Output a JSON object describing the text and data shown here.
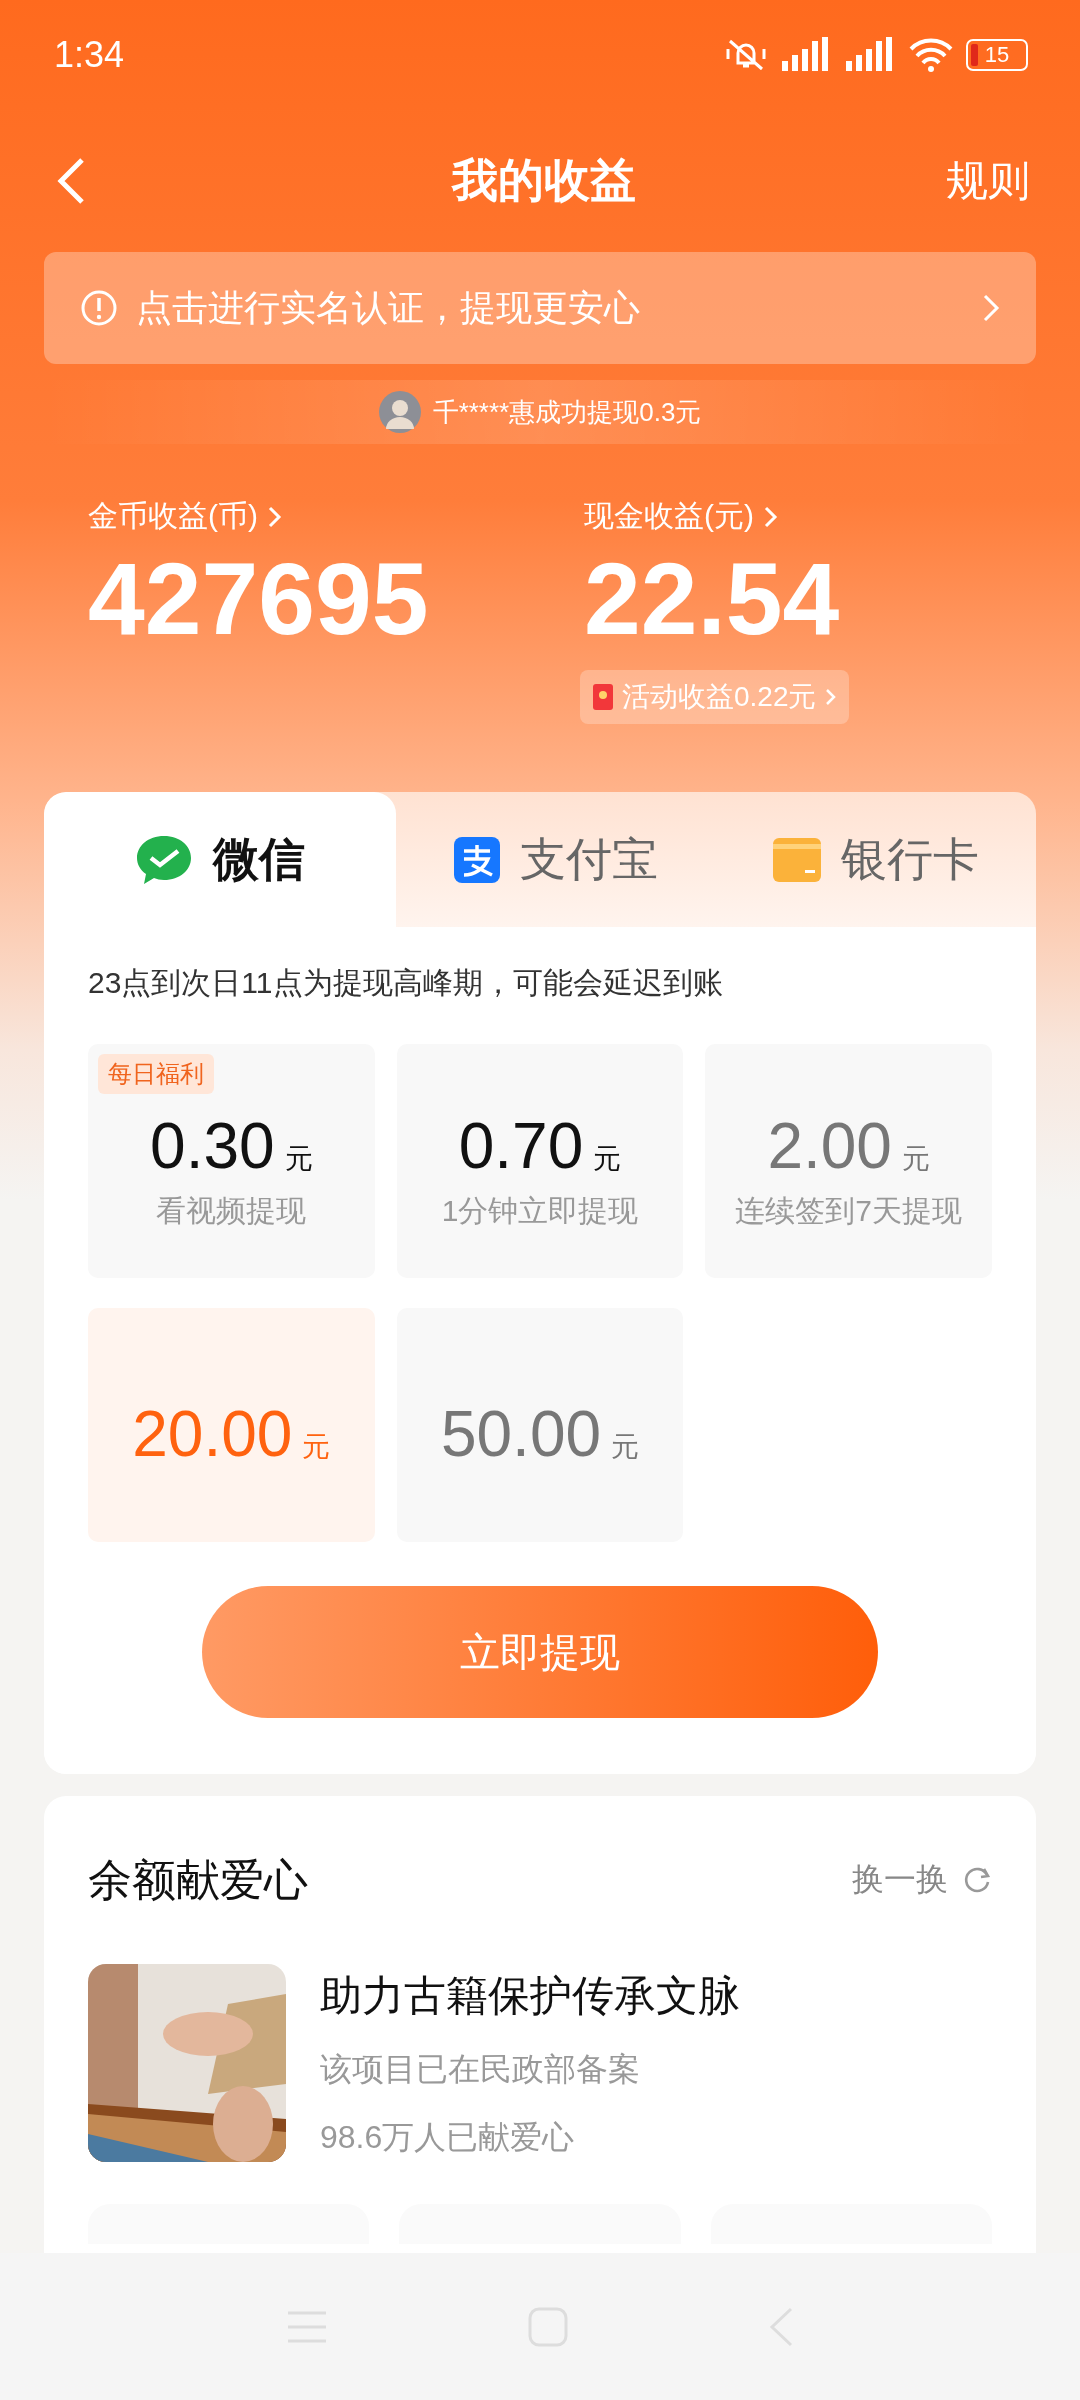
{
  "status_bar": {
    "time": "1:34",
    "battery": "15"
  },
  "nav": {
    "title": "我的收益",
    "rules": "规则"
  },
  "verify_banner": {
    "text": "点击进行实名认证，提现更安心"
  },
  "ticker": {
    "text": "千*****惠成功提现0.3元"
  },
  "stats": [
    {
      "label": "金币收益(币)",
      "value": "427695"
    },
    {
      "label": "现金收益(元)",
      "value": "22.54"
    }
  ],
  "activity_chip": {
    "text": "活动收益0.22元"
  },
  "payment_tabs": [
    {
      "kind": "wechat",
      "label": "微信",
      "selected": true
    },
    {
      "kind": "alipay",
      "label": "支付宝",
      "selected": false
    },
    {
      "kind": "bank",
      "label": "银行卡",
      "selected": false
    }
  ],
  "notice": "23点到次日11点为提现高峰期，可能会延迟到账",
  "options": [
    {
      "amount": "0.30",
      "unit": "元",
      "caption": "看视频提现",
      "badge": "每日福利",
      "selected": false,
      "disabled": false
    },
    {
      "amount": "0.70",
      "unit": "元",
      "caption": "1分钟立即提现",
      "selected": false,
      "disabled": false
    },
    {
      "amount": "2.00",
      "unit": "元",
      "caption": "连续签到7天提现",
      "selected": false,
      "disabled": true
    },
    {
      "amount": "20.00",
      "unit": "元",
      "selected": true,
      "disabled": false
    },
    {
      "amount": "50.00",
      "unit": "元",
      "selected": false,
      "disabled": true
    }
  ],
  "withdraw_button": "立即提现",
  "charity": {
    "title": "余额献爱心",
    "refresh": "换一换",
    "project": {
      "title": "助力古籍保护传承文脉",
      "subtitle": "该项目已在民政部备案",
      "supporters": "98.6万人已献爱心"
    }
  }
}
